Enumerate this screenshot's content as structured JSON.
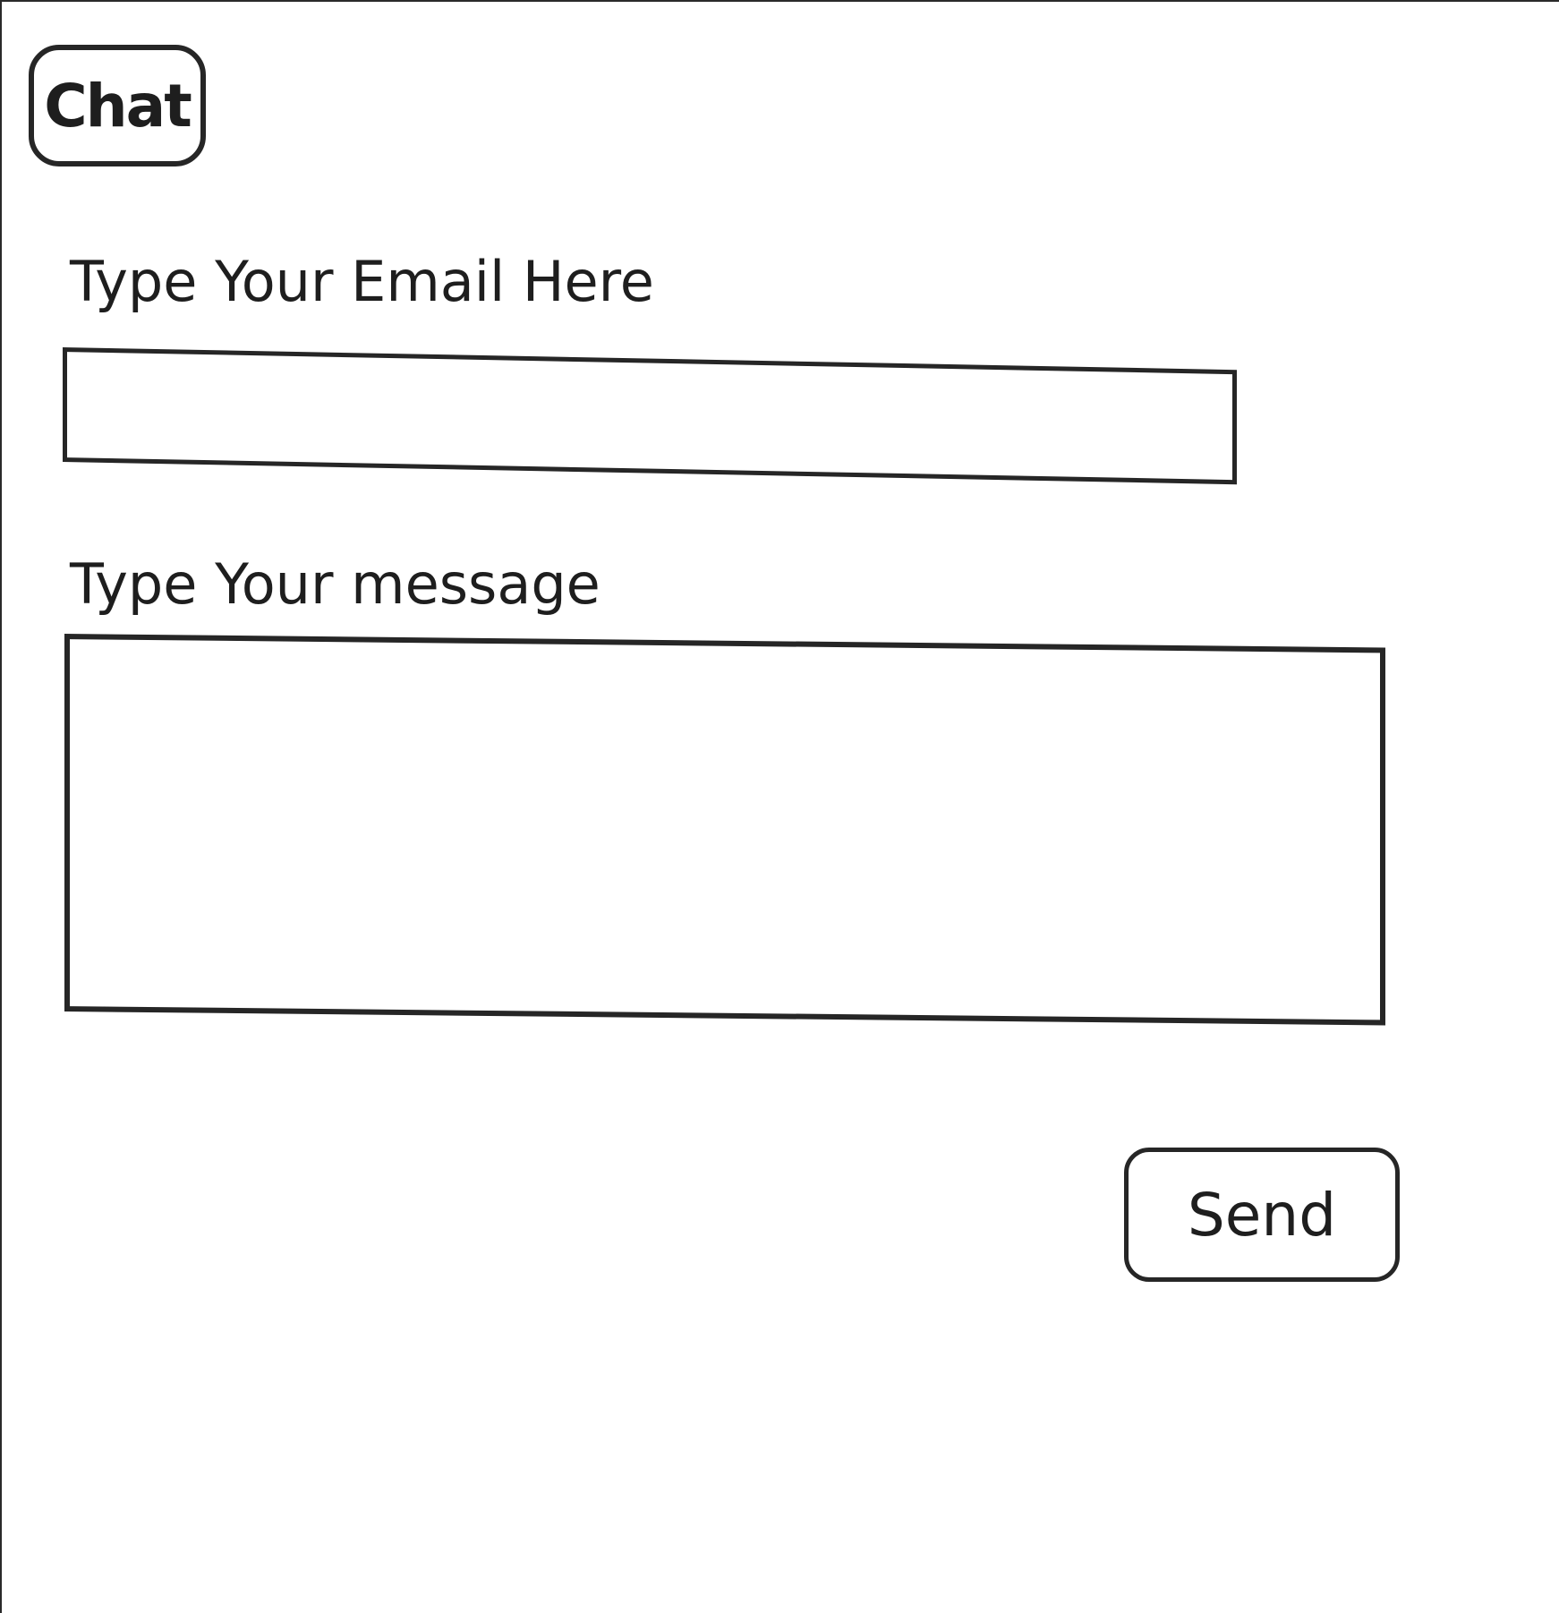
{
  "header": {
    "chat_tab_label": "Chat"
  },
  "form": {
    "email_label": "Type Your Email Here",
    "email_value": "",
    "message_label": "Type Your message",
    "message_value": "",
    "send_label": "Send"
  }
}
